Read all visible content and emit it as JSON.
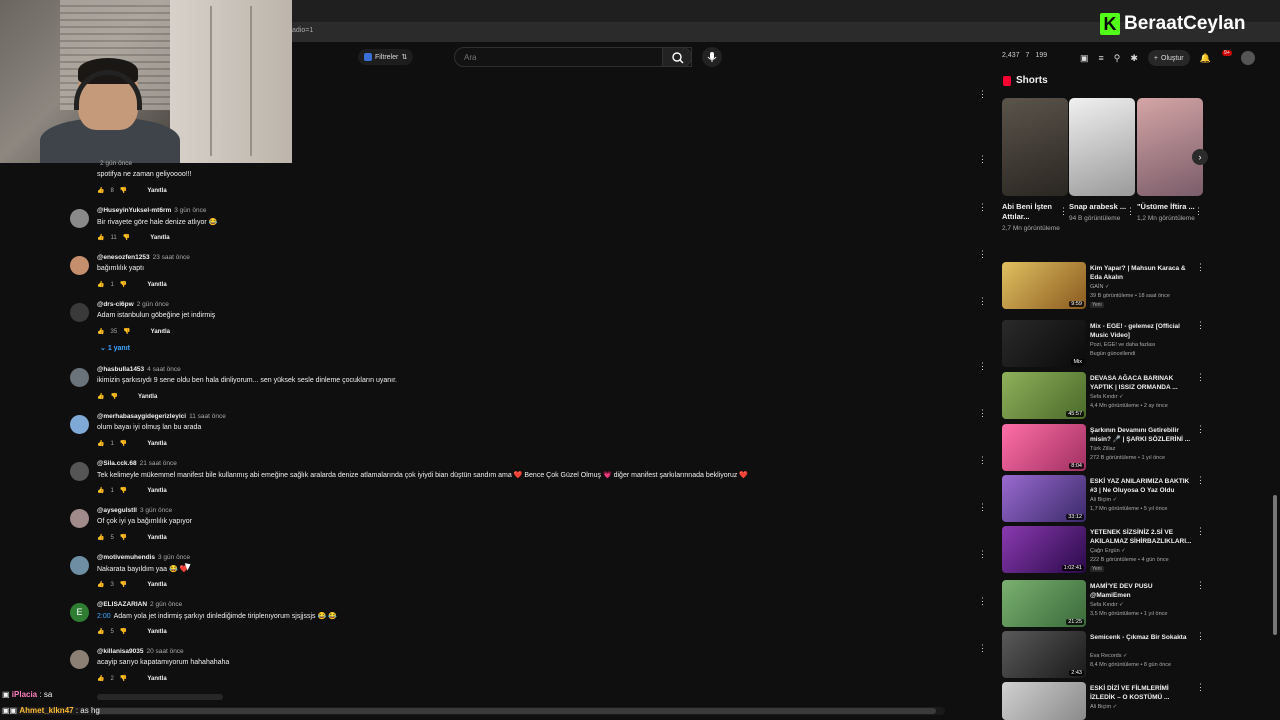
{
  "browser": {
    "url_fragment": "adio=1"
  },
  "brand": {
    "logo_letter": "K",
    "name": "BeraatCeylan"
  },
  "header": {
    "filter_label": "Filtreler",
    "search_placeholder": "Ara",
    "stats": [
      "2,437",
      "7",
      "199"
    ],
    "create_label": "Oluştur",
    "notif_count": "9+"
  },
  "comments": [
    {
      "author": "",
      "time": "2 gün önce",
      "text": "spotifya ne zaman geliyoooo!!!",
      "likes": "8",
      "reply": "Yanıtla",
      "avatar_color": "#777"
    },
    {
      "author": "@HuseyinYuksel-mt6rm",
      "time": "3 gün önce",
      "text": "Bir rivayete göre hale denize atlıyor 😂",
      "likes": "11",
      "reply": "Yanıtla",
      "avatar_color": "#8a8a8a"
    },
    {
      "author": "@enesozfen1253",
      "time": "23 saat önce",
      "text": "bağımlılık yaptı",
      "likes": "1",
      "reply": "Yanıtla",
      "avatar_color": "#c58f6e"
    },
    {
      "author": "@drs-ci6pw",
      "time": "2 gün önce",
      "text": "Adam istanbulun göbeğine jet indirmiş",
      "likes": "35",
      "reply": "Yanıtla",
      "avatar_color": "#3a3a3a"
    },
    {
      "author": "@hasbulla1453",
      "time": "4 saat önce",
      "text": "ikimizin şarkısıydı 9 sene oldu ben hala dinliyorum... sen yüksek sesle dinleme çocukların uyanır.",
      "likes": "",
      "reply": "Yanıtla",
      "avatar_color": "#6a737a"
    },
    {
      "author": "@merhabasaygidegerizleyici",
      "time": "11 saat önce",
      "text": "olum bayaı iyi olmuş lan bu arada",
      "likes": "1",
      "reply": "Yanıtla",
      "avatar_color": "#7fa9d6"
    },
    {
      "author": "@Sila.cck.68",
      "time": "21 saat önce",
      "text": "Tek kelimeyle mükemmel manifest bile kullanmış abi emeğine sağlık aralarda denize atlamalarında çok iyiydi bian düştün sandım ama ❤️ Bence Çok Güzel Olmuş 💗 diğer manifest şarkılarınnada  bekliyoruz ❤️",
      "likes": "1",
      "reply": "Yanıtla",
      "avatar_color": "#555"
    },
    {
      "author": "@aysegulstll",
      "time": "3 gün önce",
      "text": "Of çok iyi ya bağımlılık yapıyor",
      "likes": "5",
      "reply": "Yanıtla",
      "avatar_color": "#a08a8a"
    },
    {
      "author": "@motivemuhendis",
      "time": "3 gün önce",
      "text": "Nakarata bayıldım yaa 😂 ❤️",
      "likes": "3",
      "reply": "Yanıtla",
      "avatar_color": "#6d8ea3"
    },
    {
      "author": "@ELISAZARIAN",
      "time": "2 gün önce",
      "timestamp": "2:00",
      "text": "Adam yola jet indirmiş şarkıyı dinlediğimde tiriplenıyorum sjsjjssjs 😂 😂",
      "likes": "5",
      "reply": "Yanıtla",
      "avatar_color": "#2e7d32",
      "avatar_letter": "E"
    },
    {
      "author": "@killanisa9035",
      "time": "20 saat önce",
      "text": "acayip sarıyo kapatamıyorum hahahahaha",
      "likes": "2",
      "reply": "Yanıtla",
      "avatar_color": "#8c7f74"
    }
  ],
  "replies_toggle": "1 yanıt",
  "chat": [
    {
      "user": "iPlacia",
      "message": ": sa",
      "color": "#ff7fbf"
    },
    {
      "user": "Ahmet_klkn47",
      "message": ": as hg",
      "color": "#ffbb33"
    }
  ],
  "shorts": {
    "heading": "Shorts",
    "items": [
      {
        "title": "Abi Beni İşten Attılar...",
        "views": "2,7 Mn görüntüleme",
        "color": "#3a3630"
      },
      {
        "title": "Snap arabesk ...",
        "views": "94 B görüntüleme",
        "color": "#d9d9d9"
      },
      {
        "title": "\"Üstüme İftira ...",
        "views": "1,2 Mn görüntüleme",
        "color": "#b58a8a"
      }
    ]
  },
  "videos": [
    {
      "title": "Kim Yapar? | Mahsun Karaca & Eda Akalın",
      "channel": "GAİN ✓",
      "meta": "39 B görüntüleme • 18 saat önce",
      "badge": "Yeni",
      "duration": "9:59",
      "color": "#c79a3a"
    },
    {
      "title": "Mix - EGE! - gelemez [Official Music Video]",
      "channel": "Pozi, EGE! ve daha fazlası",
      "meta": "Bugün güncellendi",
      "badge": "",
      "duration": "Mix",
      "color": "#1c1c1c"
    },
    {
      "title": "DEVASA AĞACA BARINAK YAPTIK | ISSIZ ORMANDA ...",
      "channel": "Sefa Kındır ✓",
      "meta": "4,4 Mn görüntüleme • 2 ay önce",
      "badge": "",
      "duration": "45:57",
      "color": "#6b8a3c"
    },
    {
      "title": "Şarkının Devamını Getirebilir misin? 🎤 | ŞARKI SÖZLERİNİ ...",
      "channel": "Türk Zillaz",
      "meta": "272 B görüntüleme • 1 yıl önce",
      "badge": "",
      "duration": "8:04",
      "color": "#d94f8a"
    },
    {
      "title": "ESKİ YAZ ANILARIMIZA BAKTIK #3 | Ne Oluyosa O Yaz Oldu",
      "channel": "Ali Biçim ✓",
      "meta": "1,7 Mn görüntüleme • 5 yıl önce",
      "badge": "",
      "duration": "33:12",
      "color": "#7a4fb3"
    },
    {
      "title": "YETENEK SİZSİNİZ 2.Sİ VE AKILALMAZ SİHİRBAZLIKLARI...",
      "channel": "Çağrı Ergün ✓",
      "meta": "222 B görüntüleme • 4 gün önce",
      "badge": "Yeni",
      "duration": "1:02:41",
      "color": "#6a2a8a"
    },
    {
      "title": "MAMİ'YE DEV PUSU @MamiEmen",
      "channel": "Sefa Kındır ✓",
      "meta": "3,5 Mn görüntüleme • 1 yıl önce",
      "badge": "",
      "duration": "21:25",
      "color": "#5f8f5a"
    },
    {
      "title": "Semicenk - Çıkmaz Bir Sokakta",
      "channel": "Eva Records ✓",
      "meta": "8,4 Mn görüntüleme • 8 gün önce",
      "badge": "",
      "duration": "2:43",
      "color": "#444"
    },
    {
      "title": "ESKİ DİZİ VE FİLMLERİMİ İZLEDİK – O KOSTÜMÜ ...",
      "channel": "Ali Biçim ✓",
      "meta": "",
      "badge": "",
      "duration": "",
      "color": "#b0b0b0"
    }
  ]
}
